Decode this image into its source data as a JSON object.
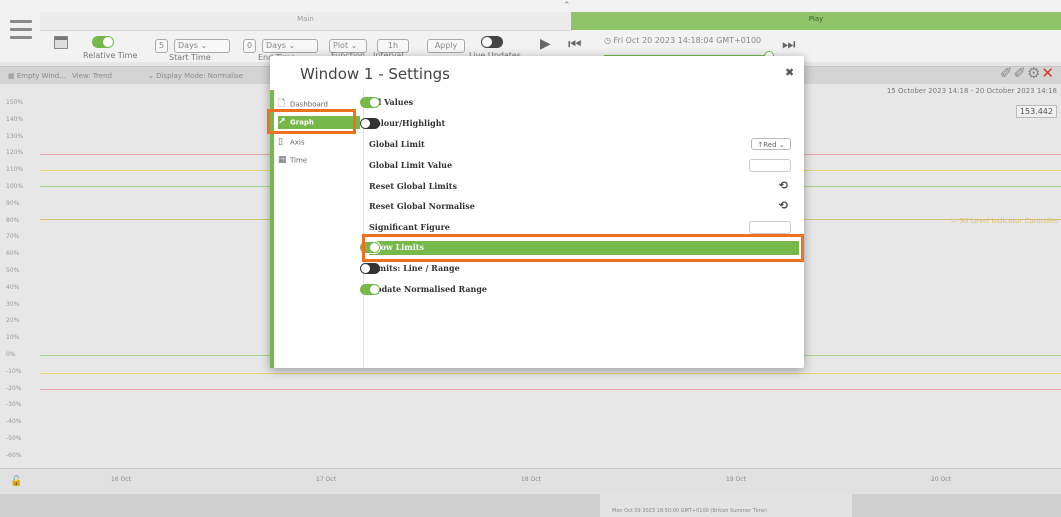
{
  "colors": {
    "accent": "#76b84a",
    "highlight": "#f07020",
    "close": "#d23b2f"
  },
  "toolbar": {
    "main_label": "Main",
    "play_label": "Play",
    "relative_time_label": "Relative Time",
    "start_time_label": "Start Time",
    "start_value": "5",
    "start_unit": "Days",
    "end_time_label": "End Time",
    "end_value": "0",
    "end_unit": "Days",
    "function_label": "Function",
    "function_value": "Plot",
    "interval_label": "Interval",
    "interval_value": "1h",
    "apply_label": "Apply",
    "live_updates_label": "Live Updates",
    "date_display": "Fri Oct 20 2023 14:18:04 GMT+0100"
  },
  "chart": {
    "header_window": "Empty Wind...",
    "header_view": "View: Trend",
    "header_display": "Display Mode: Normalise",
    "range": "15 October 2023 14:18 - 20 October 2023 14:18",
    "current_value": "153.442",
    "indicator_label": "50 Level Indicator Controller",
    "y_ticks": [
      "150%",
      "140%",
      "130%",
      "120%",
      "110%",
      "100%",
      "90%",
      "80%",
      "70%",
      "60%",
      "50%",
      "40%",
      "30%",
      "20%",
      "10%",
      "0%",
      "-10%",
      "-20%",
      "-30%",
      "-40%",
      "-50%",
      "-60%"
    ],
    "x_ticks": [
      "16 Oct",
      "17 Oct",
      "18 Oct",
      "19 Oct",
      "20 Oct"
    ],
    "scrub_label": "Mon Oct 09 2023 18:50:00 GMT+0100 (British Summer Time)"
  },
  "modal": {
    "title": "Window 1 - Settings",
    "close_glyph": "✖",
    "nav": [
      {
        "label": "Dashboard",
        "icon": "dashboard-icon"
      },
      {
        "label": "Graph",
        "icon": "graph-icon",
        "active": true
      },
      {
        "label": "Axis",
        "icon": "axis-icon"
      },
      {
        "label": "Time",
        "icon": "time-icon"
      }
    ],
    "settings": {
      "all_values": {
        "label": "All Values",
        "type": "toggle",
        "on": true
      },
      "colour_highlight": {
        "label": "Colour/Highlight",
        "type": "toggle",
        "on": false
      },
      "global_limit": {
        "label": "Global Limit",
        "type": "select",
        "value": "↑Red"
      },
      "global_limit_value": {
        "label": "Global Limit Value",
        "type": "input",
        "value": ""
      },
      "reset_global_limits": {
        "label": "Reset Global Limits",
        "type": "action",
        "icon": "refresh-icon"
      },
      "reset_global_normalise": {
        "label": "Reset Global Normalise",
        "type": "action",
        "icon": "refresh-icon"
      },
      "significant_figure": {
        "label": "Significant Figure",
        "type": "input",
        "value": ""
      },
      "show_limits": {
        "label": "Show Limits",
        "type": "toggle",
        "on": true,
        "selected": true
      },
      "limits_line_range": {
        "label": "Limits: Line / Range",
        "type": "toggle",
        "on": false
      },
      "update_normalised_range": {
        "label": "Update Normalised Range",
        "type": "toggle",
        "on": true
      }
    }
  }
}
